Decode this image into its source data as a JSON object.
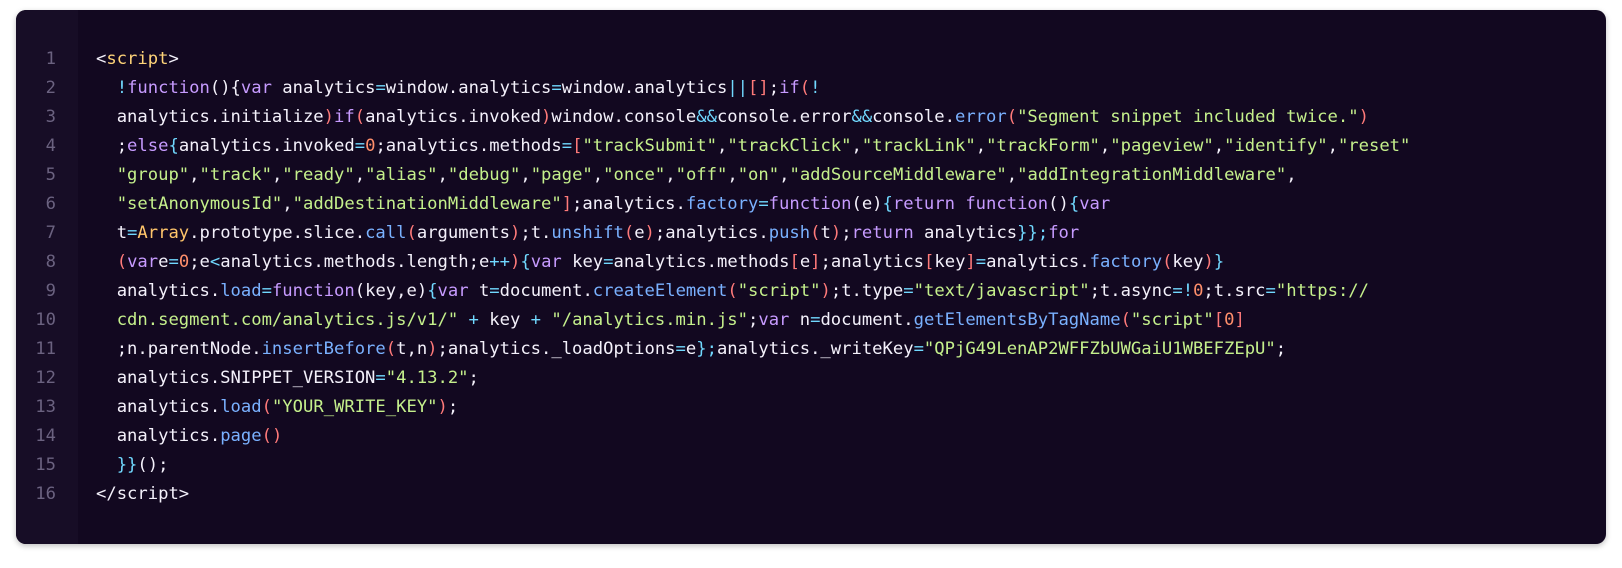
{
  "colors": {
    "background": "#120820",
    "gutter": "#170d26",
    "line_number": "#6b6280",
    "default": "#f4f1fb",
    "keyword": "#c79bff",
    "tag": "#ffd479",
    "string": "#c5f08c",
    "number": "#ff8f6b",
    "function": "#7ab1ff",
    "operator": "#71d9ff",
    "bracket": "#ff7a7a",
    "class": "#ffc56b"
  },
  "code_block": {
    "language": "html",
    "lines": [
      {
        "num": "1",
        "tokens": [
          {
            "t": "<",
            "c": "def"
          },
          {
            "t": "script",
            "c": "tag"
          },
          {
            "t": ">",
            "c": "def"
          }
        ]
      },
      {
        "num": "2",
        "tokens": [
          {
            "t": "  ",
            "c": "def"
          },
          {
            "t": "!",
            "c": "op"
          },
          {
            "t": "function",
            "c": "kw"
          },
          {
            "t": "(){",
            "c": "def"
          },
          {
            "t": "var",
            "c": "kw"
          },
          {
            "t": " analytics",
            "c": "def"
          },
          {
            "t": "=",
            "c": "op"
          },
          {
            "t": "window.analytics",
            "c": "def"
          },
          {
            "t": "=",
            "c": "op"
          },
          {
            "t": "window.analytics",
            "c": "def"
          },
          {
            "t": "||",
            "c": "op"
          },
          {
            "t": "[]",
            "c": "br"
          },
          {
            "t": ";",
            "c": "def"
          },
          {
            "t": "if",
            "c": "kw"
          },
          {
            "t": "(",
            "c": "br"
          },
          {
            "t": "!",
            "c": "op"
          }
        ]
      },
      {
        "num": "3",
        "tokens": [
          {
            "t": "  analytics.initialize",
            "c": "def"
          },
          {
            "t": ")",
            "c": "br"
          },
          {
            "t": "if",
            "c": "kw"
          },
          {
            "t": "(",
            "c": "br"
          },
          {
            "t": "analytics.invoked",
            "c": "def"
          },
          {
            "t": ")",
            "c": "br"
          },
          {
            "t": "window.console",
            "c": "def"
          },
          {
            "t": "&&",
            "c": "op"
          },
          {
            "t": "console.error",
            "c": "def"
          },
          {
            "t": "&&",
            "c": "op"
          },
          {
            "t": "console.",
            "c": "def"
          },
          {
            "t": "error",
            "c": "fn"
          },
          {
            "t": "(",
            "c": "br"
          },
          {
            "t": "\"Segment snippet included twice.\"",
            "c": "str"
          },
          {
            "t": ")",
            "c": "br"
          }
        ]
      },
      {
        "num": "4",
        "tokens": [
          {
            "t": "  ;",
            "c": "def"
          },
          {
            "t": "else",
            "c": "kw"
          },
          {
            "t": "{",
            "c": "op"
          },
          {
            "t": "analytics.invoked",
            "c": "def"
          },
          {
            "t": "=",
            "c": "op"
          },
          {
            "t": "0",
            "c": "num"
          },
          {
            "t": ";analytics.methods",
            "c": "def"
          },
          {
            "t": "=",
            "c": "op"
          },
          {
            "t": "[",
            "c": "br"
          },
          {
            "t": "\"trackSubmit\"",
            "c": "str"
          },
          {
            "t": ",",
            "c": "def"
          },
          {
            "t": "\"trackClick\"",
            "c": "str"
          },
          {
            "t": ",",
            "c": "def"
          },
          {
            "t": "\"trackLink\"",
            "c": "str"
          },
          {
            "t": ",",
            "c": "def"
          },
          {
            "t": "\"trackForm\"",
            "c": "str"
          },
          {
            "t": ",",
            "c": "def"
          },
          {
            "t": "\"pageview\"",
            "c": "str"
          },
          {
            "t": ",",
            "c": "def"
          },
          {
            "t": "\"identify\"",
            "c": "str"
          },
          {
            "t": ",",
            "c": "def"
          },
          {
            "t": "\"reset\"",
            "c": "str"
          }
        ]
      },
      {
        "num": "5",
        "tokens": [
          {
            "t": "  ",
            "c": "def"
          },
          {
            "t": "\"group\"",
            "c": "str"
          },
          {
            "t": ",",
            "c": "def"
          },
          {
            "t": "\"track\"",
            "c": "str"
          },
          {
            "t": ",",
            "c": "def"
          },
          {
            "t": "\"ready\"",
            "c": "str"
          },
          {
            "t": ",",
            "c": "def"
          },
          {
            "t": "\"alias\"",
            "c": "str"
          },
          {
            "t": ",",
            "c": "def"
          },
          {
            "t": "\"debug\"",
            "c": "str"
          },
          {
            "t": ",",
            "c": "def"
          },
          {
            "t": "\"page\"",
            "c": "str"
          },
          {
            "t": ",",
            "c": "def"
          },
          {
            "t": "\"once\"",
            "c": "str"
          },
          {
            "t": ",",
            "c": "def"
          },
          {
            "t": "\"off\"",
            "c": "str"
          },
          {
            "t": ",",
            "c": "def"
          },
          {
            "t": "\"on\"",
            "c": "str"
          },
          {
            "t": ",",
            "c": "def"
          },
          {
            "t": "\"addSourceMiddleware\"",
            "c": "str"
          },
          {
            "t": ",",
            "c": "def"
          },
          {
            "t": "\"addIntegrationMiddleware\"",
            "c": "str"
          },
          {
            "t": ",",
            "c": "def"
          }
        ]
      },
      {
        "num": "6",
        "tokens": [
          {
            "t": "  ",
            "c": "def"
          },
          {
            "t": "\"setAnonymousId\"",
            "c": "str"
          },
          {
            "t": ",",
            "c": "def"
          },
          {
            "t": "\"addDestinationMiddleware\"",
            "c": "str"
          },
          {
            "t": "]",
            "c": "br"
          },
          {
            "t": ";analytics.",
            "c": "def"
          },
          {
            "t": "factory",
            "c": "fn"
          },
          {
            "t": "=",
            "c": "op"
          },
          {
            "t": "function",
            "c": "kw"
          },
          {
            "t": "(e)",
            "c": "def"
          },
          {
            "t": "{",
            "c": "op"
          },
          {
            "t": "return",
            "c": "kw"
          },
          {
            "t": " ",
            "c": "def"
          },
          {
            "t": "function",
            "c": "kw"
          },
          {
            "t": "()",
            "c": "def"
          },
          {
            "t": "{",
            "c": "op"
          },
          {
            "t": "var",
            "c": "kw"
          }
        ]
      },
      {
        "num": "7",
        "tokens": [
          {
            "t": "  t",
            "c": "def"
          },
          {
            "t": "=",
            "c": "op"
          },
          {
            "t": "Array",
            "c": "cls"
          },
          {
            "t": ".prototype.slice.",
            "c": "def"
          },
          {
            "t": "call",
            "c": "fn"
          },
          {
            "t": "(",
            "c": "br"
          },
          {
            "t": "arguments",
            "c": "def"
          },
          {
            "t": ")",
            "c": "br"
          },
          {
            "t": ";t.",
            "c": "def"
          },
          {
            "t": "unshift",
            "c": "fn"
          },
          {
            "t": "(",
            "c": "br"
          },
          {
            "t": "e",
            "c": "def"
          },
          {
            "t": ")",
            "c": "br"
          },
          {
            "t": ";analytics.",
            "c": "def"
          },
          {
            "t": "push",
            "c": "fn"
          },
          {
            "t": "(",
            "c": "br"
          },
          {
            "t": "t",
            "c": "def"
          },
          {
            "t": ")",
            "c": "br"
          },
          {
            "t": ";",
            "c": "def"
          },
          {
            "t": "return",
            "c": "kw"
          },
          {
            "t": " analytics",
            "c": "def"
          },
          {
            "t": "}};",
            "c": "op"
          },
          {
            "t": "for",
            "c": "kw"
          }
        ]
      },
      {
        "num": "8",
        "tokens": [
          {
            "t": "  ",
            "c": "def"
          },
          {
            "t": "(",
            "c": "br"
          },
          {
            "t": "var",
            "c": "kw"
          },
          {
            "t": "e",
            "c": "def"
          },
          {
            "t": "=",
            "c": "op"
          },
          {
            "t": "0",
            "c": "num"
          },
          {
            "t": ";e",
            "c": "def"
          },
          {
            "t": "<",
            "c": "op"
          },
          {
            "t": "analytics.methods.length;e",
            "c": "def"
          },
          {
            "t": "++",
            "c": "op"
          },
          {
            "t": ")",
            "c": "br"
          },
          {
            "t": "{",
            "c": "op"
          },
          {
            "t": "var",
            "c": "kw"
          },
          {
            "t": " key",
            "c": "def"
          },
          {
            "t": "=",
            "c": "op"
          },
          {
            "t": "analytics.methods",
            "c": "def"
          },
          {
            "t": "[",
            "c": "br"
          },
          {
            "t": "e",
            "c": "def"
          },
          {
            "t": "]",
            "c": "br"
          },
          {
            "t": ";analytics",
            "c": "def"
          },
          {
            "t": "[",
            "c": "br"
          },
          {
            "t": "key",
            "c": "def"
          },
          {
            "t": "]",
            "c": "br"
          },
          {
            "t": "=",
            "c": "op"
          },
          {
            "t": "analytics.",
            "c": "def"
          },
          {
            "t": "factory",
            "c": "fn"
          },
          {
            "t": "(",
            "c": "br"
          },
          {
            "t": "key",
            "c": "def"
          },
          {
            "t": ")",
            "c": "br"
          },
          {
            "t": "}",
            "c": "op"
          }
        ]
      },
      {
        "num": "9",
        "tokens": [
          {
            "t": "  analytics.",
            "c": "def"
          },
          {
            "t": "load",
            "c": "fn"
          },
          {
            "t": "=",
            "c": "op"
          },
          {
            "t": "function",
            "c": "kw"
          },
          {
            "t": "(key,e)",
            "c": "def"
          },
          {
            "t": "{",
            "c": "op"
          },
          {
            "t": "var",
            "c": "kw"
          },
          {
            "t": " t",
            "c": "def"
          },
          {
            "t": "=",
            "c": "op"
          },
          {
            "t": "document.",
            "c": "def"
          },
          {
            "t": "createElement",
            "c": "fn"
          },
          {
            "t": "(",
            "c": "br"
          },
          {
            "t": "\"script\"",
            "c": "str"
          },
          {
            "t": ")",
            "c": "br"
          },
          {
            "t": ";t.type",
            "c": "def"
          },
          {
            "t": "=",
            "c": "op"
          },
          {
            "t": "\"text/javascript\"",
            "c": "str"
          },
          {
            "t": ";t.async",
            "c": "def"
          },
          {
            "t": "=!",
            "c": "op"
          },
          {
            "t": "0",
            "c": "num"
          },
          {
            "t": ";t.src",
            "c": "def"
          },
          {
            "t": "=",
            "c": "op"
          },
          {
            "t": "\"https://",
            "c": "str"
          }
        ]
      },
      {
        "num": "10",
        "tokens": [
          {
            "t": "  ",
            "c": "def"
          },
          {
            "t": "cdn.segment.com/analytics.js/v1/\"",
            "c": "str"
          },
          {
            "t": " ",
            "c": "def"
          },
          {
            "t": "+",
            "c": "op"
          },
          {
            "t": " key ",
            "c": "def"
          },
          {
            "t": "+",
            "c": "op"
          },
          {
            "t": " ",
            "c": "def"
          },
          {
            "t": "\"/analytics.min.js\"",
            "c": "str"
          },
          {
            "t": ";",
            "c": "def"
          },
          {
            "t": "var",
            "c": "kw"
          },
          {
            "t": " n",
            "c": "def"
          },
          {
            "t": "=",
            "c": "op"
          },
          {
            "t": "document.",
            "c": "def"
          },
          {
            "t": "getElementsByTagName",
            "c": "fn"
          },
          {
            "t": "(",
            "c": "br"
          },
          {
            "t": "\"script\"",
            "c": "str"
          },
          {
            "t": "[",
            "c": "br"
          },
          {
            "t": "0",
            "c": "num"
          },
          {
            "t": "]",
            "c": "br"
          }
        ]
      },
      {
        "num": "11",
        "tokens": [
          {
            "t": "  ;n.parentNode.",
            "c": "def"
          },
          {
            "t": "insertBefore",
            "c": "fn"
          },
          {
            "t": "(",
            "c": "br"
          },
          {
            "t": "t,n",
            "c": "def"
          },
          {
            "t": ")",
            "c": "br"
          },
          {
            "t": ";analytics._loadOptions",
            "c": "def"
          },
          {
            "t": "=",
            "c": "op"
          },
          {
            "t": "e",
            "c": "def"
          },
          {
            "t": "};",
            "c": "op"
          },
          {
            "t": "analytics._writeKey",
            "c": "def"
          },
          {
            "t": "=",
            "c": "op"
          },
          {
            "t": "\"QPjG49LenAP2WFFZbUWGaiU1WBEFZEpU\"",
            "c": "str"
          },
          {
            "t": ";",
            "c": "def"
          }
        ]
      },
      {
        "num": "12",
        "tokens": [
          {
            "t": "  analytics.SNIPPET_VERSION",
            "c": "def"
          },
          {
            "t": "=",
            "c": "op"
          },
          {
            "t": "\"4.13.2\"",
            "c": "str"
          },
          {
            "t": ";",
            "c": "def"
          }
        ]
      },
      {
        "num": "13",
        "tokens": [
          {
            "t": "  analytics.",
            "c": "def"
          },
          {
            "t": "load",
            "c": "fn"
          },
          {
            "t": "(",
            "c": "br"
          },
          {
            "t": "\"YOUR_WRITE_KEY\"",
            "c": "str"
          },
          {
            "t": ")",
            "c": "br"
          },
          {
            "t": ";",
            "c": "def"
          }
        ]
      },
      {
        "num": "14",
        "tokens": [
          {
            "t": "  analytics.",
            "c": "def"
          },
          {
            "t": "page",
            "c": "fn"
          },
          {
            "t": "()",
            "c": "br"
          }
        ]
      },
      {
        "num": "15",
        "tokens": [
          {
            "t": "  ",
            "c": "def"
          },
          {
            "t": "}}",
            "c": "op"
          },
          {
            "t": "();",
            "c": "def"
          }
        ]
      },
      {
        "num": "16",
        "tokens": [
          {
            "t": "</",
            "c": "def"
          },
          {
            "t": "script",
            "c": "def"
          },
          {
            "t": ">",
            "c": "def"
          }
        ]
      }
    ]
  }
}
